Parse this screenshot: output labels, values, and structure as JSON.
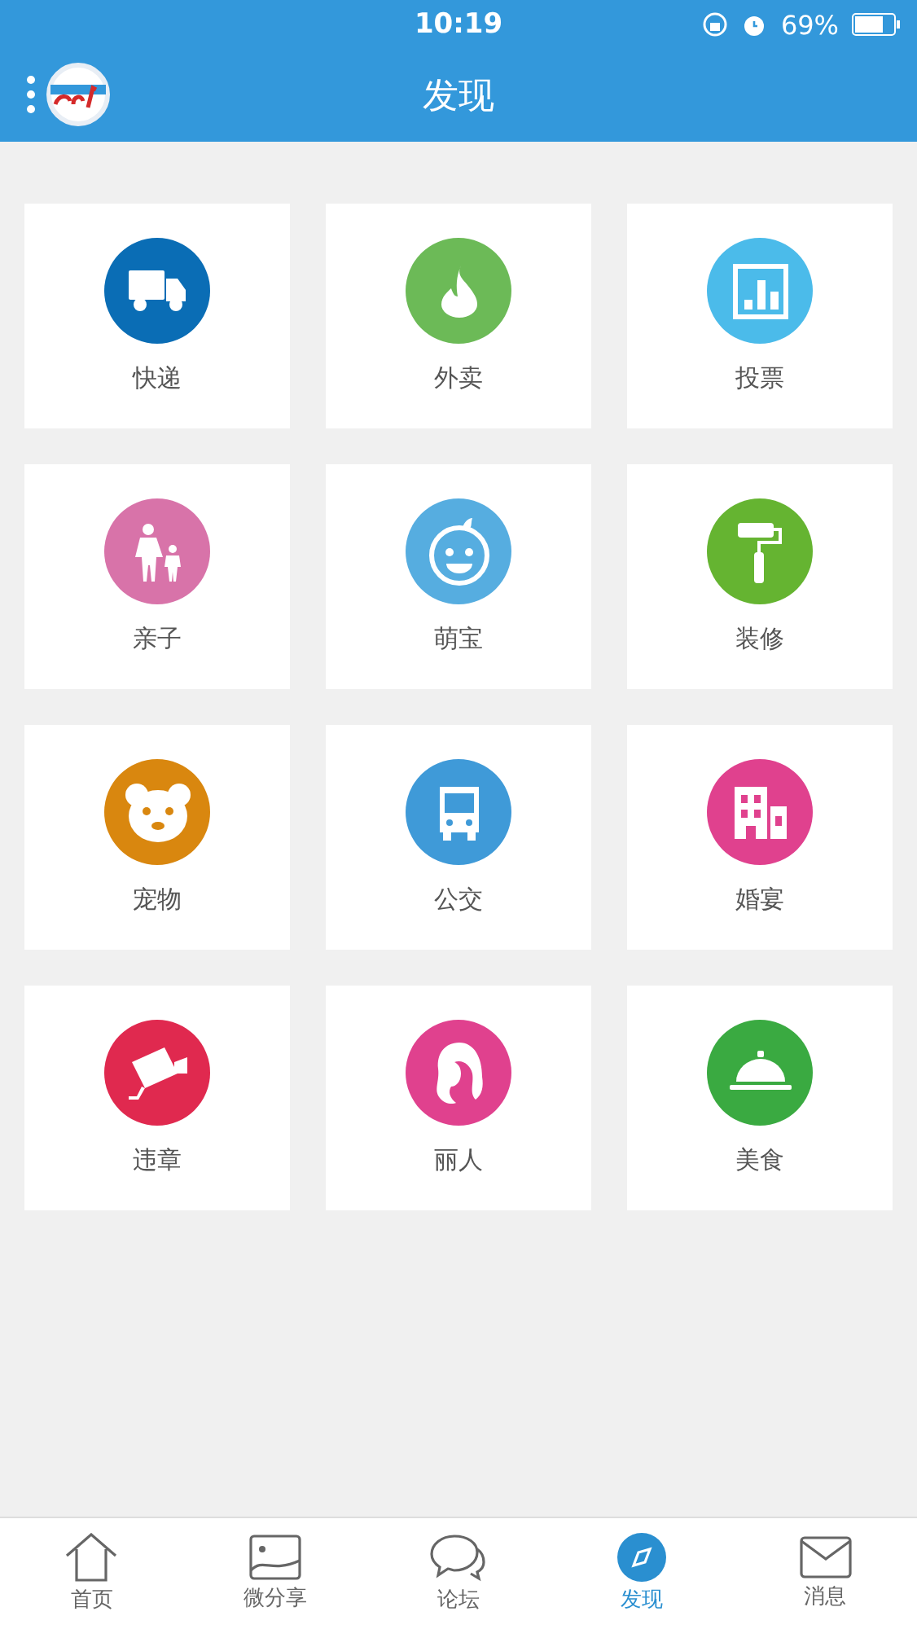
{
  "status_bar": {
    "time": "10:19",
    "battery": "69%"
  },
  "header": {
    "title": "发现"
  },
  "tiles": [
    {
      "label": "快递",
      "color": "#0a6db5"
    },
    {
      "label": "外卖",
      "color": "#6cba57"
    },
    {
      "label": "投票",
      "color": "#4bbbea"
    },
    {
      "label": "亲子",
      "color": "#d873a9"
    },
    {
      "label": "萌宝",
      "color": "#56ade0"
    },
    {
      "label": "装修",
      "color": "#65b431"
    },
    {
      "label": "宠物",
      "color": "#d9870f"
    },
    {
      "label": "公交",
      "color": "#3f9ad8"
    },
    {
      "label": "婚宴",
      "color": "#e0418e"
    },
    {
      "label": "违章",
      "color": "#e0294f"
    },
    {
      "label": "丽人",
      "color": "#e0418e"
    },
    {
      "label": "美食",
      "color": "#3aaa41"
    }
  ],
  "tab_bar": [
    {
      "label": "首页",
      "selected": false
    },
    {
      "label": "微分享",
      "selected": false
    },
    {
      "label": "论坛",
      "selected": false
    },
    {
      "label": "发现",
      "selected": true
    },
    {
      "label": "消息",
      "selected": false
    }
  ]
}
